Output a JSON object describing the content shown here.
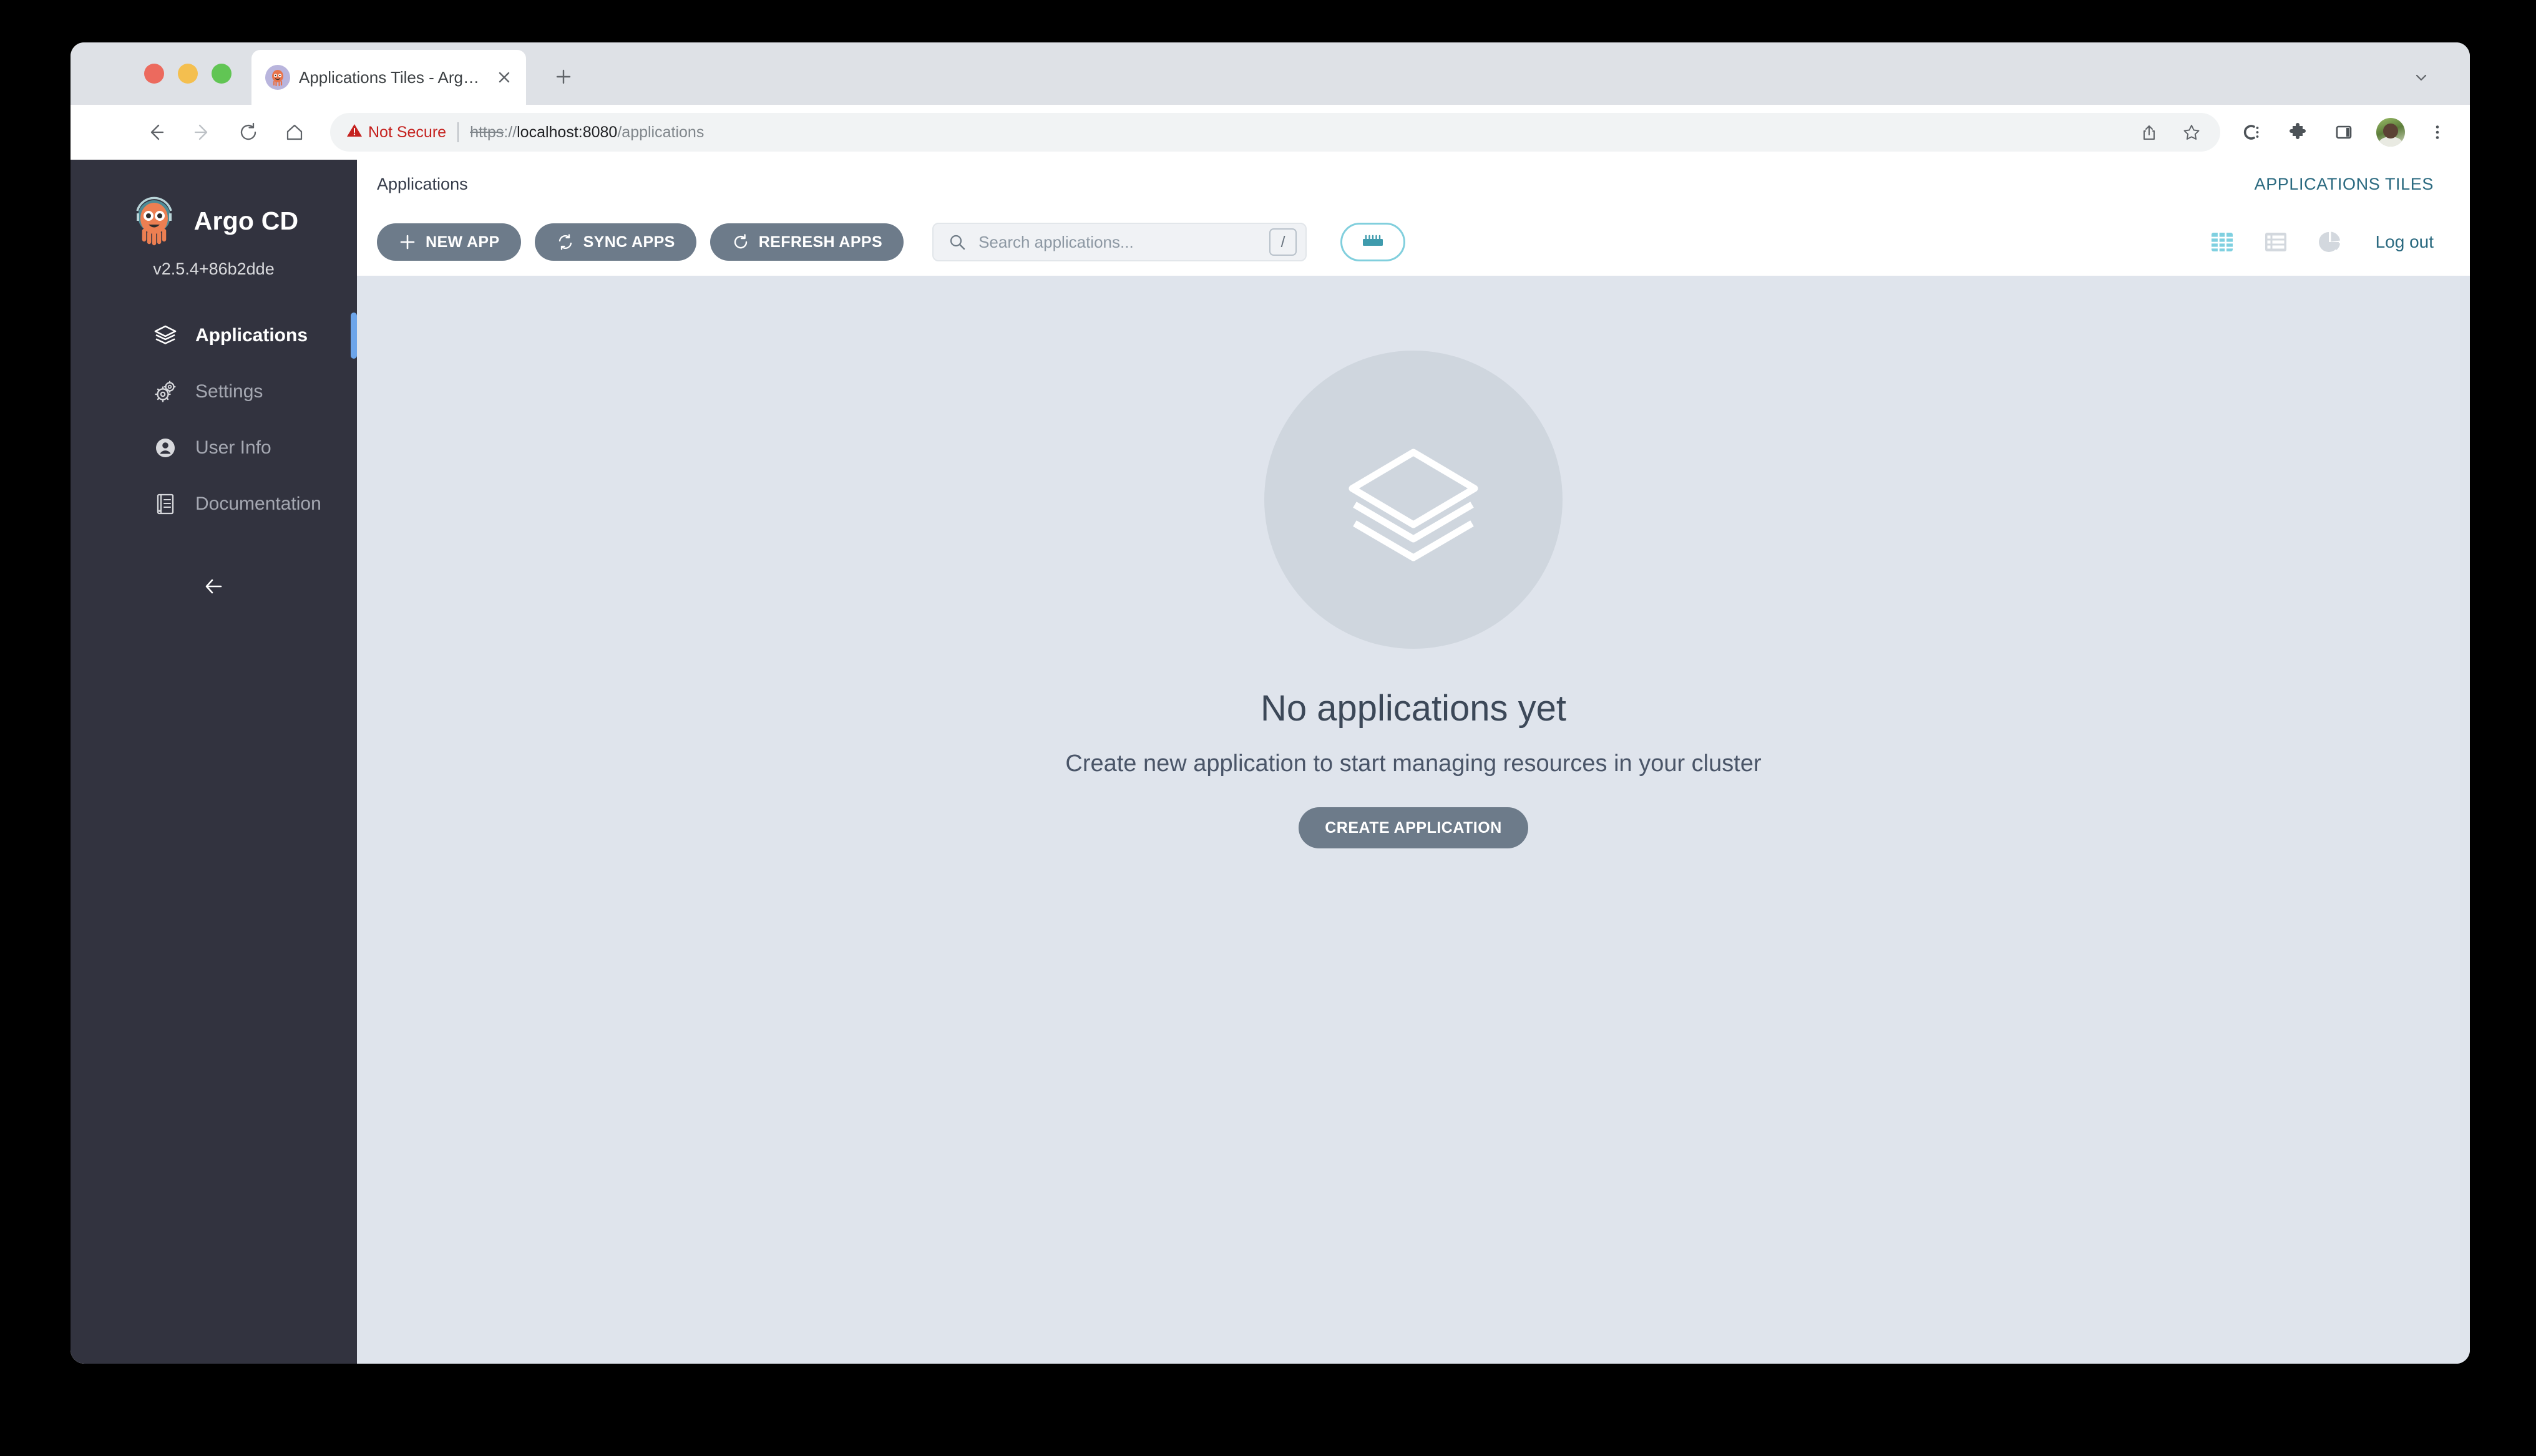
{
  "browser": {
    "tab": {
      "title": "Applications Tiles - Argo CD",
      "favicon_name": "argocd-favicon",
      "close_label": "×",
      "new_tab_label": "+",
      "tabstrip_caret_label": "⌄"
    },
    "nav": {
      "back_label": "←",
      "forward_label": "→",
      "reload_label": "↻",
      "home_label": "⌂"
    },
    "omnibox": {
      "security_label": "Not Secure",
      "security_icon": "warning-triangle-icon",
      "url_scheme": "https",
      "url_separator": "://",
      "url_host": "localhost:8080",
      "url_path": "/applications",
      "share_icon": "share-icon",
      "bookmark_icon": "star-icon"
    },
    "extensions": {
      "colorzilla_icon": "colorzilla-icon",
      "puzzle_icon": "extensions-puzzle-icon",
      "sidepanel_icon": "side-panel-icon",
      "avatar_icon": "profile-avatar",
      "menu_icon": "three-dot-menu-icon"
    }
  },
  "sidebar": {
    "brand_name": "Argo CD",
    "brand_logo_icon": "argo-octopus-logo",
    "version": "v2.5.4+86b2dde",
    "items": [
      {
        "label": "Applications",
        "icon": "layers-icon",
        "active": true
      },
      {
        "label": "Settings",
        "icon": "gear-icon",
        "active": false
      },
      {
        "label": "User Info",
        "icon": "user-circle-icon",
        "active": false
      },
      {
        "label": "Documentation",
        "icon": "book-icon",
        "active": false
      }
    ],
    "collapse_icon": "arrow-left-icon"
  },
  "header": {
    "breadcrumb": "Applications",
    "tiles_link": "APPLICATIONS TILES"
  },
  "toolbar": {
    "new_app_label": "NEW APP",
    "new_app_icon": "plus-icon",
    "sync_apps_label": "SYNC APPS",
    "sync_apps_icon": "sync-icon",
    "refresh_apps_label": "REFRESH APPS",
    "refresh_apps_icon": "refresh-icon",
    "search_placeholder": "Search applications...",
    "search_value": "",
    "search_icon": "search-icon",
    "search_shortcut": "/",
    "filter_icon": "filter-sliders-icon",
    "view_tiles_icon": "grid-view-icon",
    "view_list_icon": "list-view-icon",
    "view_summary_icon": "pie-chart-icon",
    "logout_label": "Log out",
    "active_view": "tiles"
  },
  "empty_state": {
    "illustration_icon": "layers-stack-icon",
    "title": "No applications yet",
    "subtitle": "Create new application to start managing resources in your cluster",
    "cta_label": "CREATE APPLICATION"
  },
  "colors": {
    "sidebar_bg": "#32333f",
    "content_bg": "#dfe4ec",
    "accent_teal": "#7fd0e0",
    "link_teal": "#2b6a80",
    "button_slate": "#6d7b8a",
    "active_indicator_blue": "#6da5ea",
    "not_secure_red": "#c5221f"
  }
}
